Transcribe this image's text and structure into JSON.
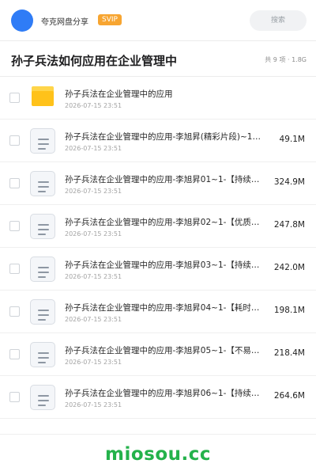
{
  "header": {
    "brand_label": "夸克网盘分享",
    "badge_label": "SVIP",
    "search_placeholder": "搜索"
  },
  "folder": {
    "title": "孙子兵法如何应用在企业管理中",
    "meta": "共 9 项 · 1.8G"
  },
  "files": [
    {
      "type": "folder-icon",
      "name": "孙子兵法在企业管理中的应用",
      "date": "2026-07-15 23:51",
      "size": ""
    },
    {
      "type": "document-icon",
      "name": "孙子兵法在企业管理中的应用-李旭昇(精彩片段)~1…",
      "date": "2026-07-15 23:51",
      "size": "49.1M"
    },
    {
      "type": "document-icon",
      "name": "孙子兵法在企业管理中的应用-李旭昇01~1-【持续…",
      "date": "2026-07-15 23:51",
      "size": "324.9M"
    },
    {
      "type": "document-icon",
      "name": "孙子兵法在企业管理中的应用-李旭昇02~1-【优质…",
      "date": "2026-07-15 23:51",
      "size": "247.8M"
    },
    {
      "type": "document-icon",
      "name": "孙子兵法在企业管理中的应用-李旭昇03~1-【持续…",
      "date": "2026-07-15 23:51",
      "size": "242.0M"
    },
    {
      "type": "document-icon",
      "name": "孙子兵法在企业管理中的应用-李旭昇04~1-【耗时…",
      "date": "2026-07-15 23:51",
      "size": "198.1M"
    },
    {
      "type": "document-icon",
      "name": "孙子兵法在企业管理中的应用-李旭昇05~1-【不易…",
      "date": "2026-07-15 23:51",
      "size": "218.4M"
    },
    {
      "type": "document-icon",
      "name": "孙子兵法在企业管理中的应用-李旭昇06~1-【持续…",
      "date": "2026-07-15 23:51",
      "size": "264.6M"
    }
  ],
  "watermark": "miosou.cc",
  "colors": {
    "accent": "#2f7cf6",
    "badge": "#f7a531",
    "folder": "#ffc21a",
    "watermark": "#24b24b"
  }
}
